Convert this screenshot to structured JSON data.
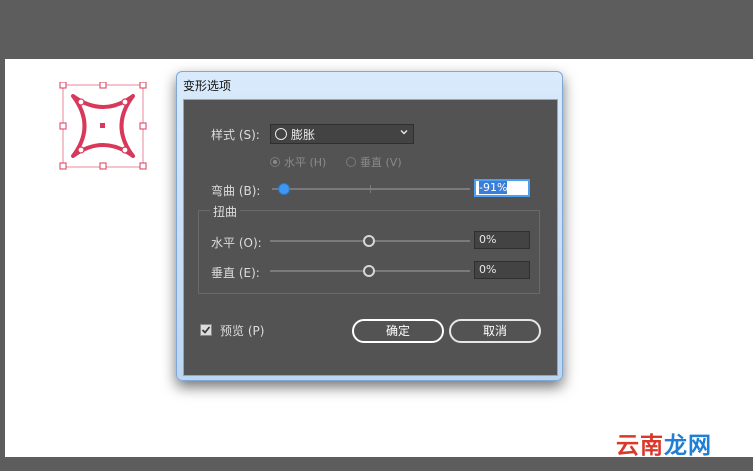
{
  "dialog": {
    "title": "变形选项",
    "style_label": "样式 (S):",
    "style_value": "膨胀",
    "orientation": {
      "horizontal_label": "水平 (H)",
      "vertical_label": "垂直 (V)",
      "selected": "horizontal"
    },
    "bend_label": "弯曲 (B):",
    "bend_value": "-91%",
    "bend_percent": -91,
    "distortion": {
      "group_label": "扭曲",
      "horizontal_label": "水平 (O):",
      "horizontal_value": "0%",
      "vertical_label": "垂直 (E):",
      "vertical_value": "0%"
    },
    "preview_label": "预览 (P)",
    "preview_checked": true,
    "ok_label": "确定",
    "cancel_label": "取消"
  },
  "colors": {
    "shape_stroke": "#d8385a",
    "slider_accent": "#3f97f2",
    "dialog_bg": "#535353"
  },
  "watermark": {
    "part1": "云南",
    "part2": "龙网"
  }
}
